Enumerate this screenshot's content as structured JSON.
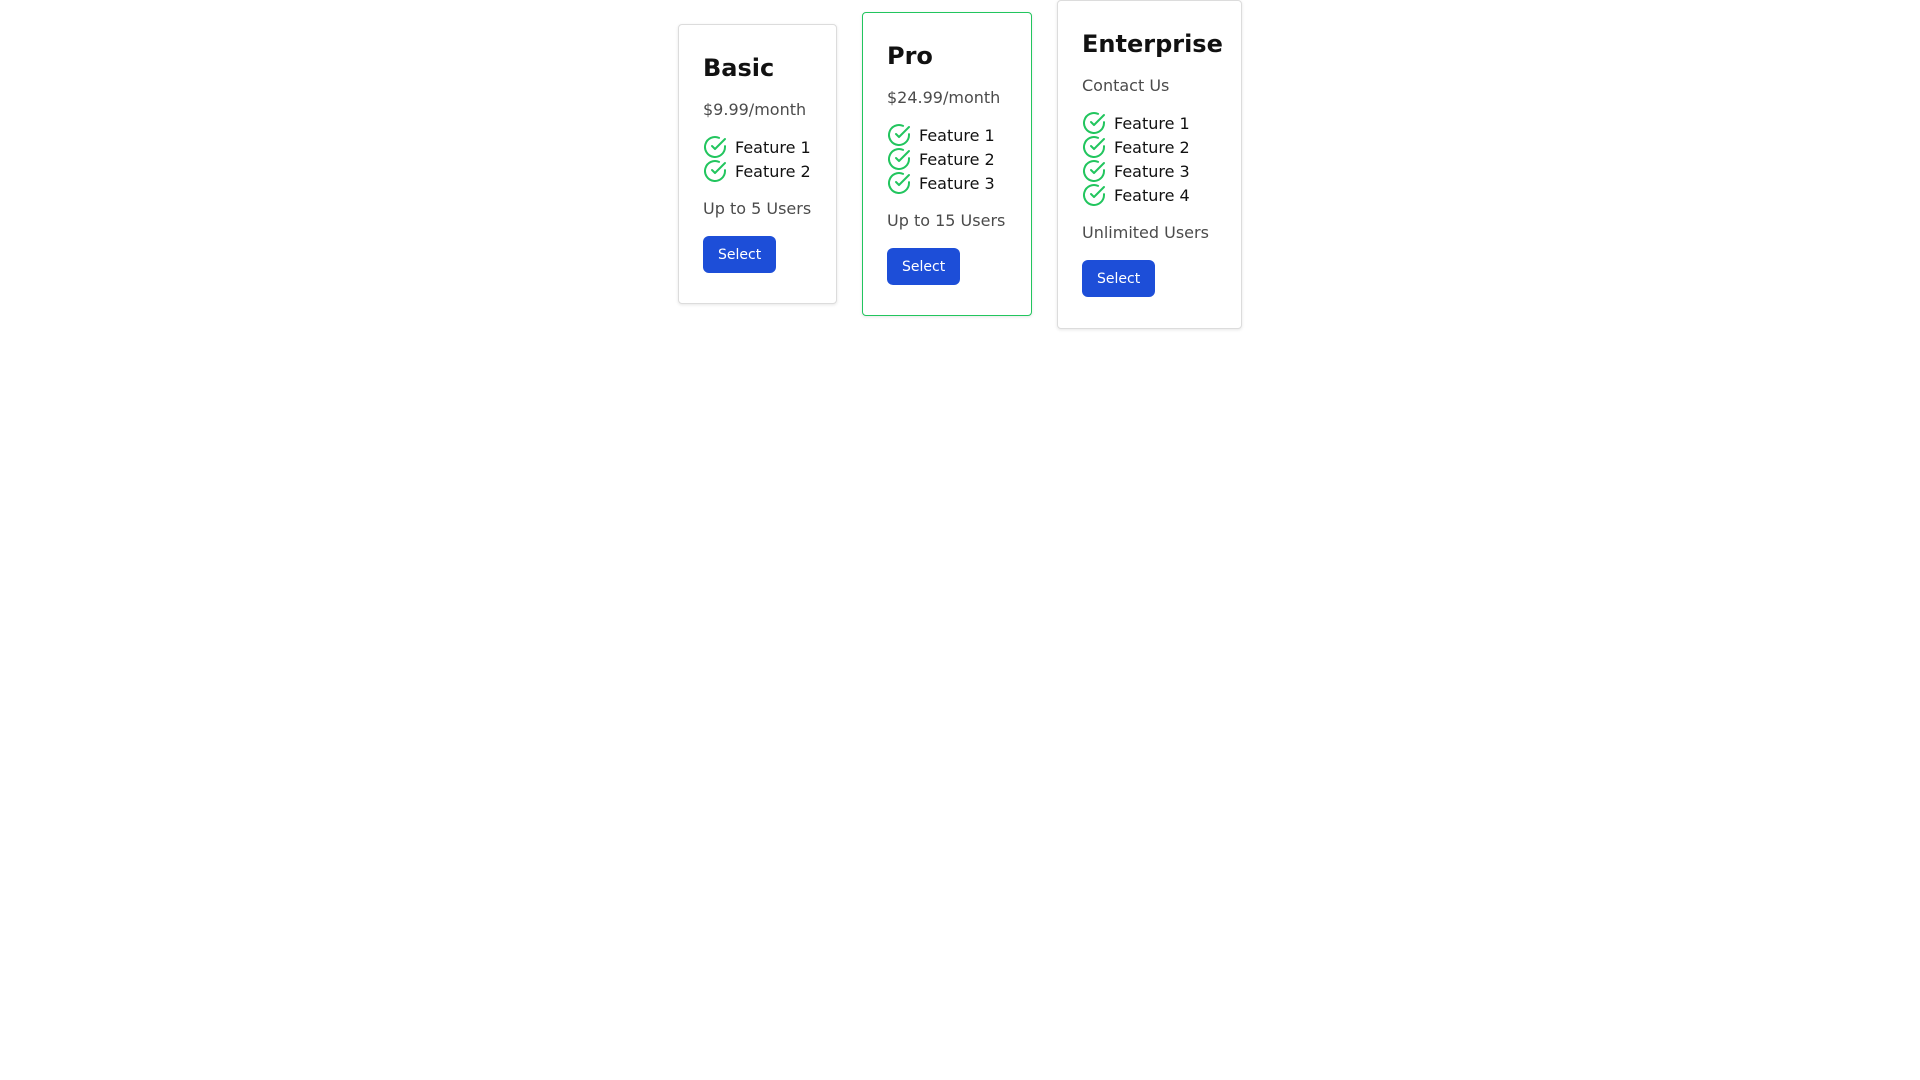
{
  "plans": [
    {
      "title": "Basic",
      "price": "$9.99/month",
      "features": [
        "Feature 1",
        "Feature 2"
      ],
      "users": "Up to 5 Users",
      "button_label": "Select"
    },
    {
      "title": "Pro",
      "price": "$24.99/month",
      "features": [
        "Feature 1",
        "Feature 2",
        "Feature 3"
      ],
      "users": "Up to 15 Users",
      "button_label": "Select"
    },
    {
      "title": "Enterprise",
      "price": "Contact Us",
      "features": [
        "Feature 1",
        "Feature 2",
        "Feature 3",
        "Feature 4"
      ],
      "users": "Unlimited Users",
      "button_label": "Select"
    }
  ],
  "colors": {
    "accent": "#1d4ed8",
    "check": "#22c55e",
    "highlight_border": "#22c55e"
  },
  "icons": {
    "feature": "check-circle-icon"
  }
}
